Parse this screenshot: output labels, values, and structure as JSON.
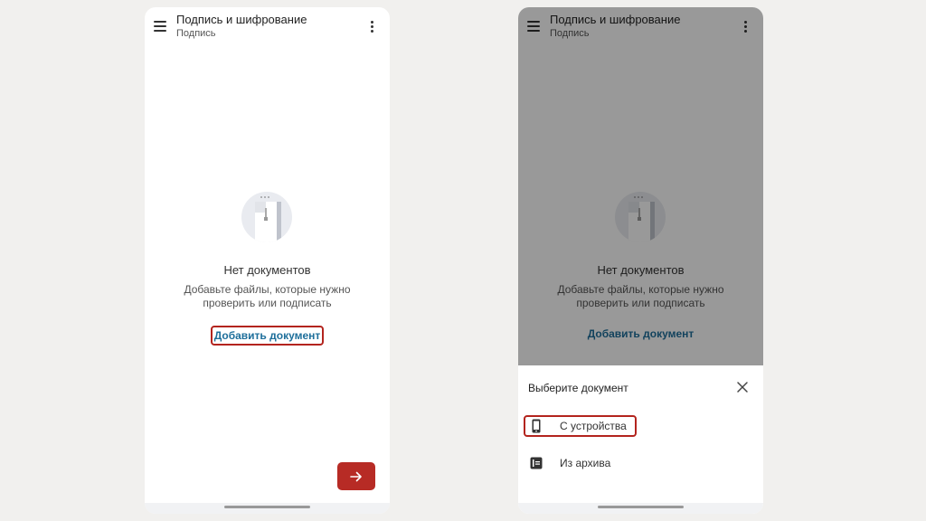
{
  "app": {
    "title": "Подпись и шифрование",
    "subtitle": "Подпись"
  },
  "empty_state": {
    "title": "Нет документов",
    "description_line1": "Добавьте файлы, которые нужно",
    "description_line2": "проверить или подписать",
    "add_link": "Добавить документ"
  },
  "icons": {
    "menu": "hamburger-menu-icon",
    "more": "more-vertical-icon",
    "fab": "arrow-right-icon",
    "close": "close-icon",
    "device": "phone-icon",
    "archive": "archive-icon"
  },
  "sheet": {
    "title": "Выберите документ",
    "options": [
      {
        "label": "С устройства"
      },
      {
        "label": "Из архива"
      }
    ]
  },
  "colors": {
    "accent": "#b72b25",
    "link": "#1e6f9b",
    "highlight_border": "#b3241e",
    "background": "#f1f0ee"
  }
}
